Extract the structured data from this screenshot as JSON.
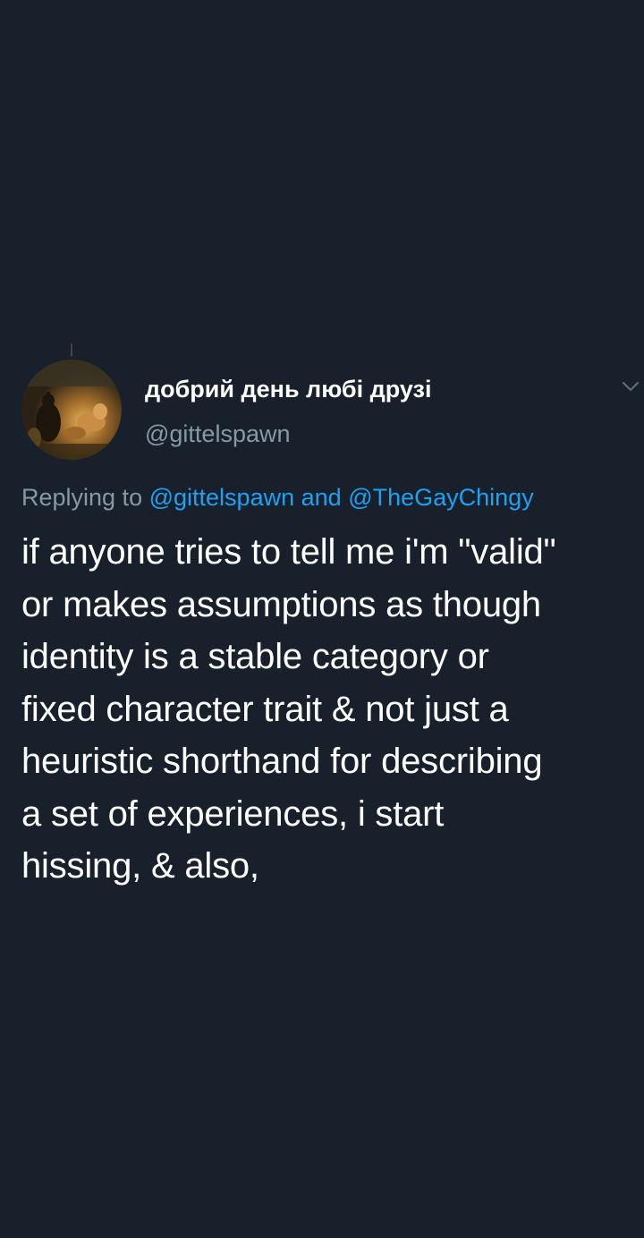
{
  "tweet": {
    "display_name": "добрий день любі друзі",
    "handle": "@gittelspawn",
    "replying_prefix": "Replying to",
    "reply_mentions": [
      "@gittelspawn",
      "@TheGayChingy"
    ],
    "reply_conjunction": "and",
    "text": "if anyone tries to tell me i'm \"valid\"\nor makes assumptions as though\nidentity is a stable category or\nfixed character trait & not just a\nheuristic shorthand for describing\na set of experiences, i start\nhissing, & also,",
    "avatar_icon": "painting-avatar-icon",
    "menu_icon": "chevron-down-icon"
  },
  "colors": {
    "background": "#17202b",
    "primary_text": "#ffffff",
    "secondary_text": "#8899a6",
    "link": "#1da1f2"
  }
}
